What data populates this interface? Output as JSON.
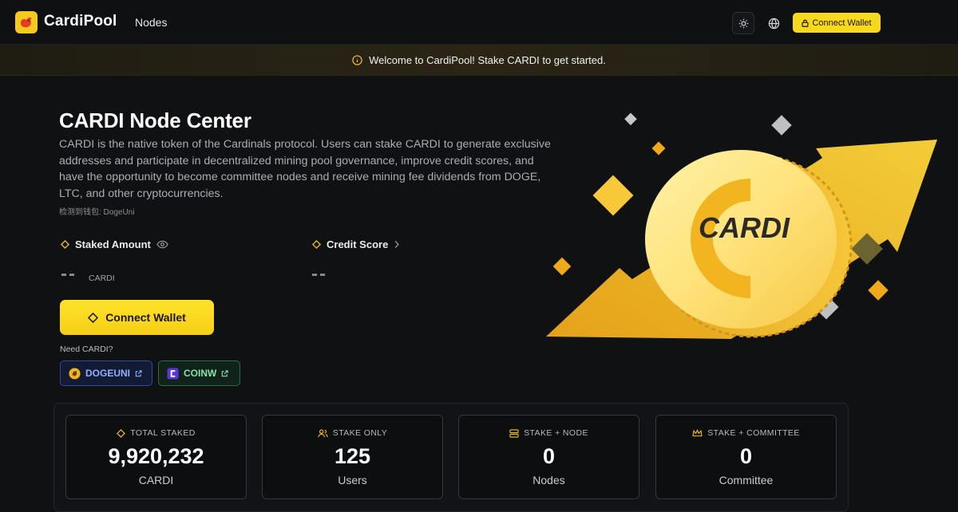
{
  "header": {
    "brand": "CardiPool",
    "nav_nodes": "Nodes",
    "connect_label": "Connect Wallet"
  },
  "banner": {
    "message": "Welcome to CardiPool! Stake CARDI to get started."
  },
  "hero": {
    "title": "CARDI Node Center",
    "description": "CARDI is the native token of the Cardinals protocol. Users can stake CARDI to generate exclusive addresses and participate in decentralized mining pool governance, improve credit scores, and have the opportunity to become committee nodes and receive mining fee dividends from DOGE, LTC, and other cryptocurrencies.",
    "detected_wallet": "检测到钱包: DogeUni",
    "staked_label": "Staked Amount",
    "staked_value": "--",
    "staked_unit": "CARDI",
    "credit_label": "Credit Score",
    "credit_value": "--",
    "connect_label": "Connect Wallet",
    "need_cardi": "Need CARDI?",
    "exchanges": [
      {
        "label": "DOGEUNI"
      },
      {
        "label": "COINW"
      }
    ],
    "coin_text": "CARDI"
  },
  "stats": [
    {
      "label": "TOTAL STAKED",
      "value": "9,920,232",
      "unit": "CARDI"
    },
    {
      "label": "STAKE ONLY",
      "value": "125",
      "unit": "Users"
    },
    {
      "label": "STAKE + NODE",
      "value": "0",
      "unit": "Nodes"
    },
    {
      "label": "STAKE + COMMITTEE",
      "value": "0",
      "unit": "Committee"
    }
  ],
  "colors": {
    "accent": "#f8d81d",
    "background": "#101113"
  }
}
